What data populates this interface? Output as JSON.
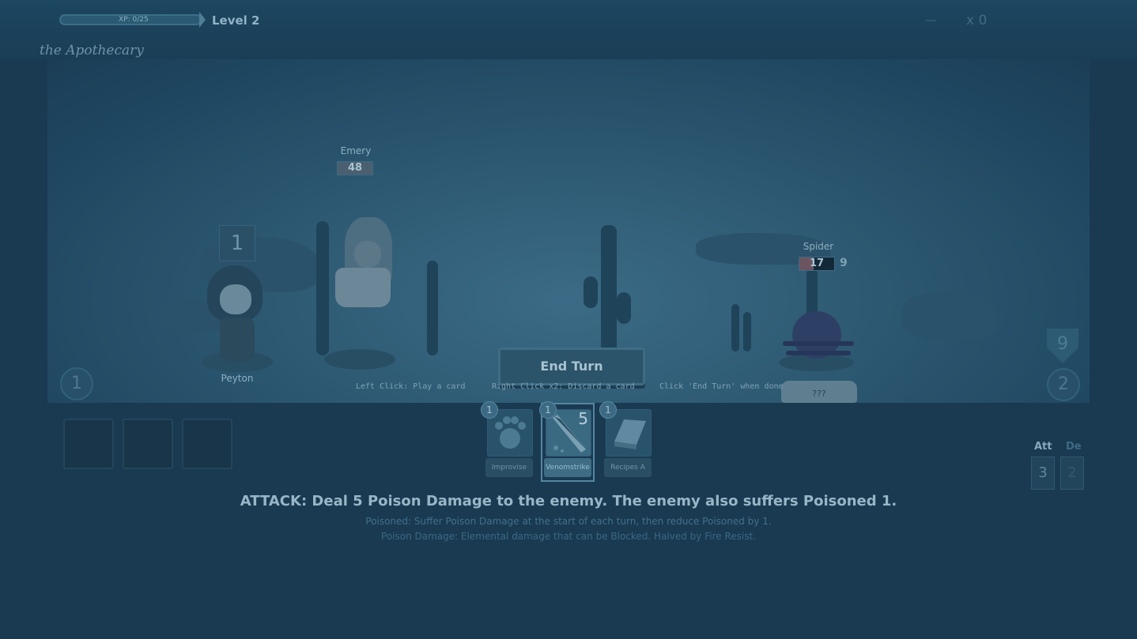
{
  "header": {
    "xp_text": "XP: 0/25",
    "xp_progress": 0,
    "level": "Level 2",
    "right_label": "—",
    "right_counter": "x 0",
    "subtitle": "the Apothecary"
  },
  "party": {
    "hero": {
      "name": "Peyton",
      "turn_badge": "1"
    },
    "ally": {
      "name": "Emery",
      "hp": "48"
    }
  },
  "enemy": {
    "name": "Spider",
    "hp": "17",
    "block": "9",
    "intent": "???"
  },
  "end_turn_label": "End Turn",
  "hints": {
    "left_click": "Left Click: Play a card",
    "right_click": "Right Click x2: Discard a card",
    "end_turn": "Click 'End Turn' when done"
  },
  "side_badges": {
    "left_circle": "1",
    "right_shield": "9",
    "right_circle": "2"
  },
  "hand": [
    {
      "name": "Improvise",
      "cost": "1",
      "icon": "paw-icon"
    },
    {
      "name": "Venomstrike",
      "cost": "1",
      "value": "5",
      "icon": "blade-icon",
      "selected": true
    },
    {
      "name": "Recipes A",
      "cost": "1",
      "icon": "book-icon"
    }
  ],
  "description": {
    "main": "ATTACK: Deal 5 Poison Damage to the enemy. The enemy also suffers Poisoned 1.",
    "sub1": "Poisoned: Suffer Poison Damage at the start of each turn, then reduce Poisoned by 1.",
    "sub2": "Poison Damage: Elemental damage that can be Blocked. Halved by Fire Resist."
  },
  "stats": {
    "att_label": "Att",
    "att_value": "3",
    "def_label": "De",
    "def_value": "2"
  },
  "colors": {
    "background": "#1a3a52",
    "scene": "#2c5770",
    "accent": "#3f6c85"
  }
}
